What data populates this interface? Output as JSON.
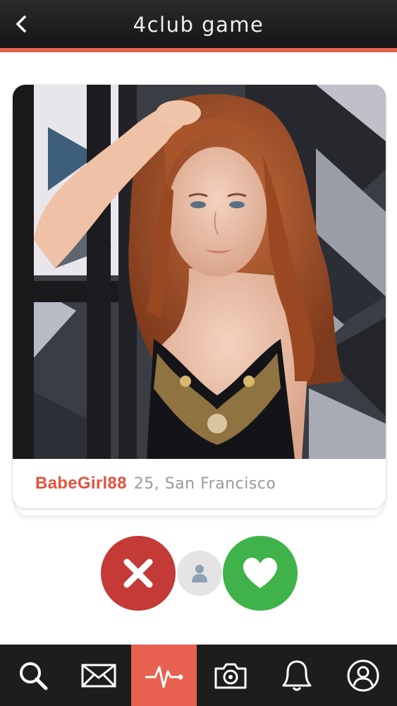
{
  "header": {
    "title": "4club game",
    "back_icon": "chevron-left-icon"
  },
  "card": {
    "name": "BabeGirl88",
    "meta": "25, San Francisco",
    "photo": "profile-photo"
  },
  "actions": [
    {
      "name": "nope",
      "icon": "x-icon",
      "color": "#c33a36"
    },
    {
      "name": "profile",
      "icon": "person-icon",
      "color": "#e4e4e4"
    },
    {
      "name": "like",
      "icon": "heart-icon",
      "color": "#3fb24a"
    }
  ],
  "tabs": [
    {
      "id": "search",
      "icon": "search-icon",
      "active": false
    },
    {
      "id": "messages",
      "icon": "envelope-icon",
      "active": false
    },
    {
      "id": "activity",
      "icon": "pulse-icon",
      "active": true
    },
    {
      "id": "camera",
      "icon": "camera-icon",
      "active": false
    },
    {
      "id": "notifications",
      "icon": "bell-icon",
      "active": false
    },
    {
      "id": "profile",
      "icon": "user-icon",
      "active": false
    }
  ],
  "colors": {
    "accent": "#e8604f",
    "header_bg": "#1f1f1f",
    "name_color": "#e0533f",
    "like": "#3fb24a",
    "nope": "#c33a36"
  }
}
